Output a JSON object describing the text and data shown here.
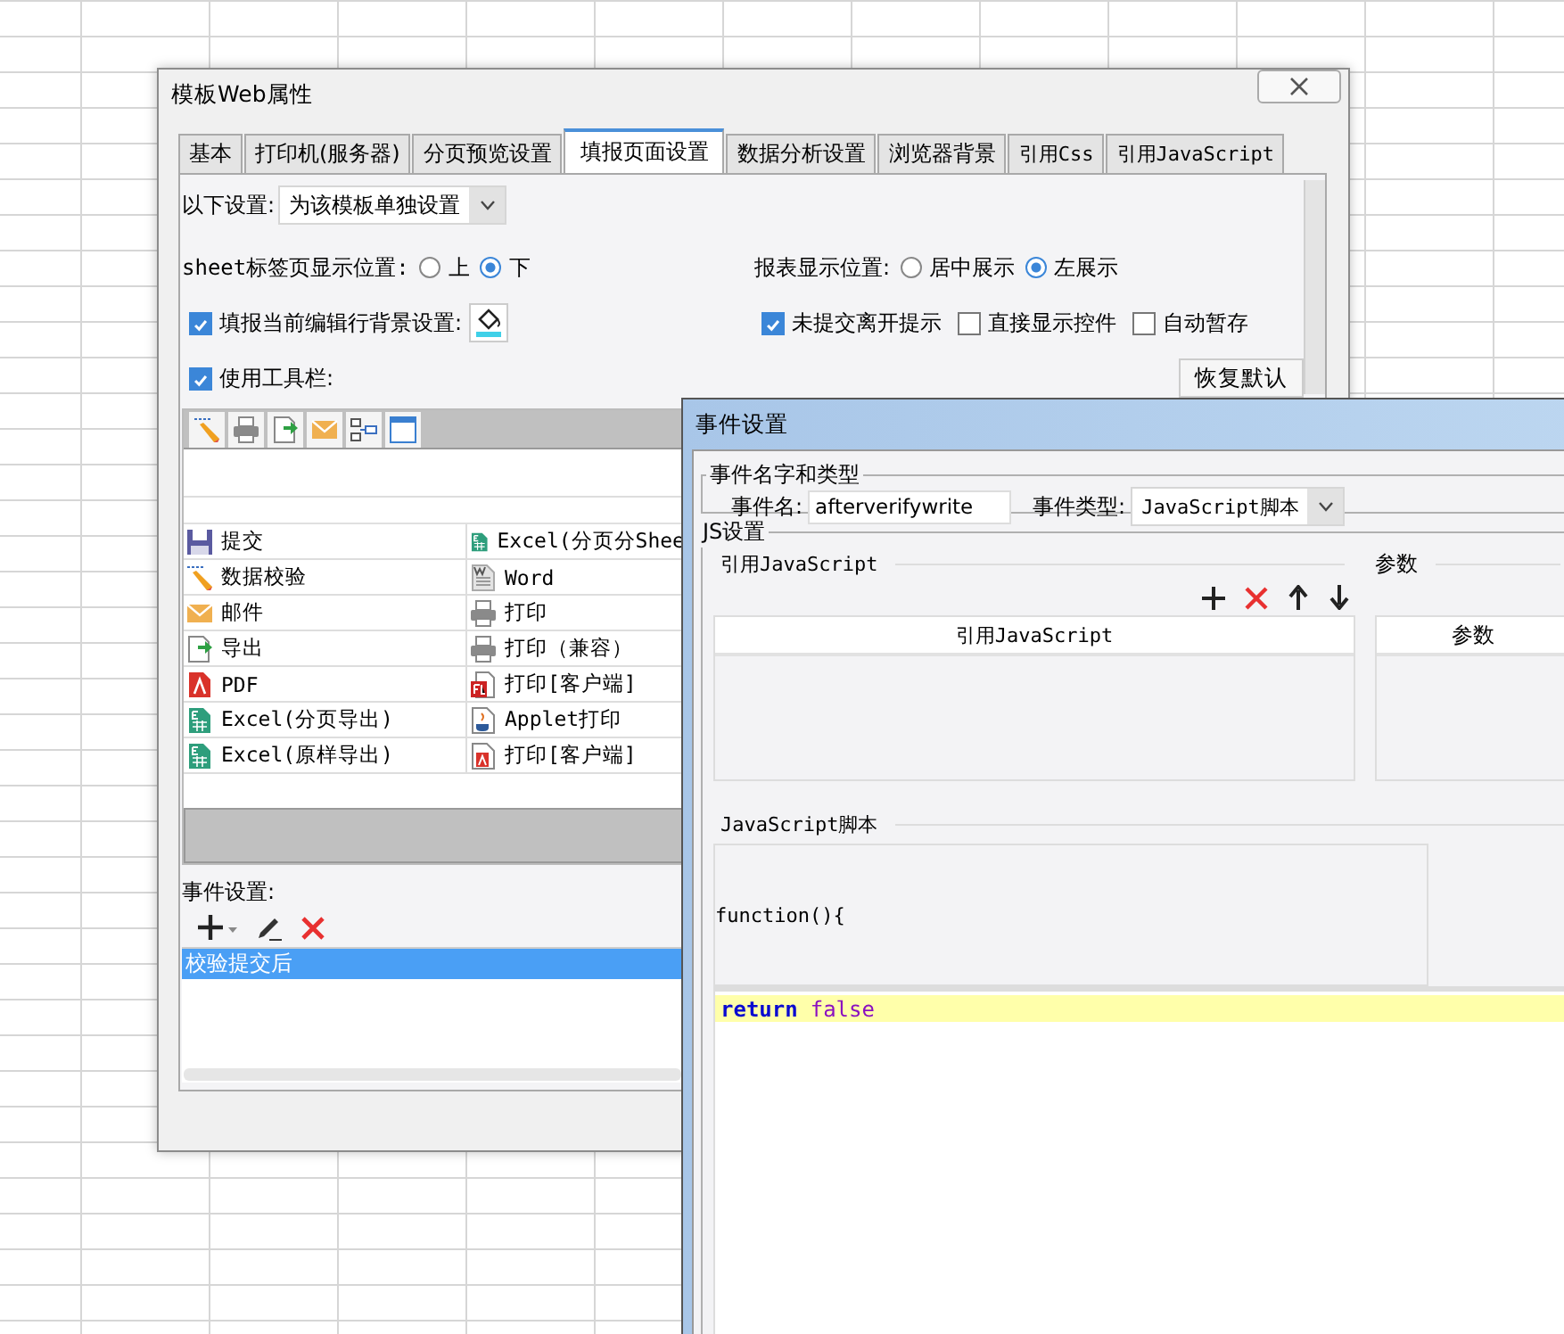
{
  "main_window": {
    "title": "模板Web属性"
  },
  "tabs": [
    {
      "label": "基本",
      "selected": false
    },
    {
      "label": "打印机(服务器)",
      "selected": false
    },
    {
      "label": "分页预览设置",
      "selected": false
    },
    {
      "label": "填报页面设置",
      "selected": true
    },
    {
      "label": "数据分析设置",
      "selected": false
    },
    {
      "label": "浏览器背景",
      "selected": false
    },
    {
      "label": "引用Css",
      "selected": false
    },
    {
      "label": "引用JavaScript",
      "selected": false
    }
  ],
  "scope": {
    "label": "以下设置:",
    "value": "为该模板单独设置"
  },
  "sheet_tab_position": {
    "label": "sheet标签页显示位置:",
    "options": [
      {
        "label": "上",
        "selected": false
      },
      {
        "label": "下",
        "selected": true
      }
    ]
  },
  "report_position": {
    "label": "报表显示位置:",
    "options": [
      {
        "label": "居中展示",
        "selected": false
      },
      {
        "label": "左展示",
        "selected": true
      }
    ]
  },
  "row_highlight": {
    "label": "填报当前编辑行背景设置:",
    "checked": true
  },
  "options": [
    {
      "label": "未提交离开提示",
      "checked": true
    },
    {
      "label": "直接显示控件",
      "checked": false
    },
    {
      "label": "自动暂存",
      "checked": false
    }
  ],
  "use_toolbar": {
    "label": "使用工具栏:",
    "checked": true
  },
  "restore_button": "恢复默认",
  "toolbar_buttons": [
    {
      "kind": "verify"
    },
    {
      "kind": "print"
    },
    {
      "kind": "export"
    },
    {
      "kind": "email"
    },
    {
      "kind": "layout"
    },
    {
      "kind": "window"
    }
  ],
  "toolbar_items": [
    {
      "label": "提交",
      "kind": "submit"
    },
    {
      "label": "Excel(分页分Shee",
      "kind": "excel"
    },
    {
      "label": "数据校验",
      "kind": "verify"
    },
    {
      "label": "Word",
      "kind": "word"
    },
    {
      "label": "邮件",
      "kind": "email"
    },
    {
      "label": "打印",
      "kind": "print"
    },
    {
      "label": "导出",
      "kind": "export"
    },
    {
      "label": "打印（兼容）",
      "kind": "print"
    },
    {
      "label": "PDF",
      "kind": "pdf"
    },
    {
      "label": "打印[客户端]",
      "kind": "flash"
    },
    {
      "label": "Excel(分页导出)",
      "kind": "excel"
    },
    {
      "label": "Applet打印",
      "kind": "applet"
    },
    {
      "label": "Excel(原样导出)",
      "kind": "excel"
    },
    {
      "label": "打印[客户端]",
      "kind": "pdfdoc"
    }
  ],
  "event_settings": {
    "label": "事件设置:",
    "events": [
      {
        "label": "校验提交后",
        "selected": true
      }
    ]
  },
  "event_dialog": {
    "title": "事件设置",
    "name_group": "事件名字和类型",
    "name_label": "事件名:",
    "name_value": "afterverifywrite",
    "type_label": "事件类型:",
    "type_value": "JavaScript脚本",
    "js_group": "JS设置",
    "references_label": "引用JavaScript",
    "params_label": "参数",
    "references_column": "引用JavaScript",
    "params_column": "参数",
    "script_label": "JavaScript脚本",
    "function_header": "function(){",
    "code_lines": [
      {
        "highlighted": true,
        "tokens": [
          {
            "text": "return",
            "kind": "keyword"
          },
          {
            "text": "false",
            "kind": "literal"
          }
        ]
      }
    ]
  }
}
